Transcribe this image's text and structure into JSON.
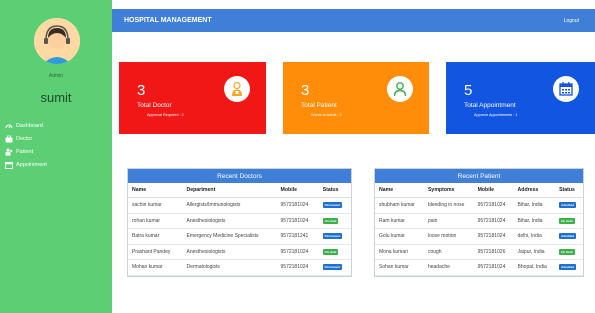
{
  "app": {
    "title": "HOSPITAL MANAGEMENT",
    "logout_label": "Logout"
  },
  "user": {
    "role": "Admin",
    "name": "sumit"
  },
  "sidebar": {
    "items": [
      {
        "label": "Dashboard",
        "icon": "dashboard-icon"
      },
      {
        "label": "Doctor",
        "icon": "doctor-icon"
      },
      {
        "label": "Patient",
        "icon": "patient-icon"
      },
      {
        "label": "Appointment",
        "icon": "calendar-icon"
      }
    ]
  },
  "cards": [
    {
      "count": "3",
      "label": "Total Doctor",
      "sub": "Approval Required : 2",
      "color": "#f21717",
      "icon": "doctor-icon"
    },
    {
      "count": "3",
      "label": "Total Patient",
      "sub": "Wants to Admit : 2",
      "color": "#ff8d0a",
      "icon": "user-icon"
    },
    {
      "count": "5",
      "label": "Total Appointment",
      "sub": "Approve Appointments : 1",
      "color": "#1155e0",
      "icon": "calendar-icon"
    }
  ],
  "doctors": {
    "title": "Recent Doctors",
    "headers": [
      "Name",
      "Department",
      "Mobile",
      "Status"
    ],
    "rows": [
      {
        "name": "sachin kumar",
        "department": "Allergists/Immunologists",
        "mobile": "9572181024",
        "status": "Permanent"
      },
      {
        "name": "rohan kumar",
        "department": "Anesthesiologists",
        "mobile": "9572181024",
        "status": "On Hold"
      },
      {
        "name": "Batra kumar",
        "department": "Emergency Medicine Specialists",
        "mobile": "9572181241",
        "status": "Permanent"
      },
      {
        "name": "Prashant Pandey",
        "department": "Anesthesiologists",
        "mobile": "9572181024",
        "status": "On Hold"
      },
      {
        "name": "Mohan kumar",
        "department": "Dermatologists",
        "mobile": "9572181024",
        "status": "Permanent"
      }
    ]
  },
  "patients": {
    "title": "Recent Patient",
    "headers": [
      "Name",
      "Symptoms",
      "Mobile",
      "Address",
      "Status"
    ],
    "rows": [
      {
        "name": "shubham kumar",
        "symptoms": "bleeding in nose",
        "mobile": "9572181024",
        "address": "Bihar, India",
        "status": "Admitted"
      },
      {
        "name": "Ram kumar",
        "symptoms": "pain",
        "mobile": "9572181024",
        "address": "Bihar, India",
        "status": "On Hold"
      },
      {
        "name": "Golu kumar",
        "symptoms": "loose motion",
        "mobile": "9572181024",
        "address": "delhi, India",
        "status": "Admitted"
      },
      {
        "name": "Mona kumari",
        "symptoms": "cough",
        "mobile": "9572181026",
        "address": "Jaipur, India",
        "status": "On Hold"
      },
      {
        "name": "Sohan kumar",
        "symptoms": "headache",
        "mobile": "9572181024",
        "address": "Bhopal, India",
        "status": "Admitted"
      }
    ]
  },
  "status_colors": {
    "Permanent": "#1f6fd1",
    "On Hold": "#3cb04a",
    "Admitted": "#1f6fd1"
  }
}
